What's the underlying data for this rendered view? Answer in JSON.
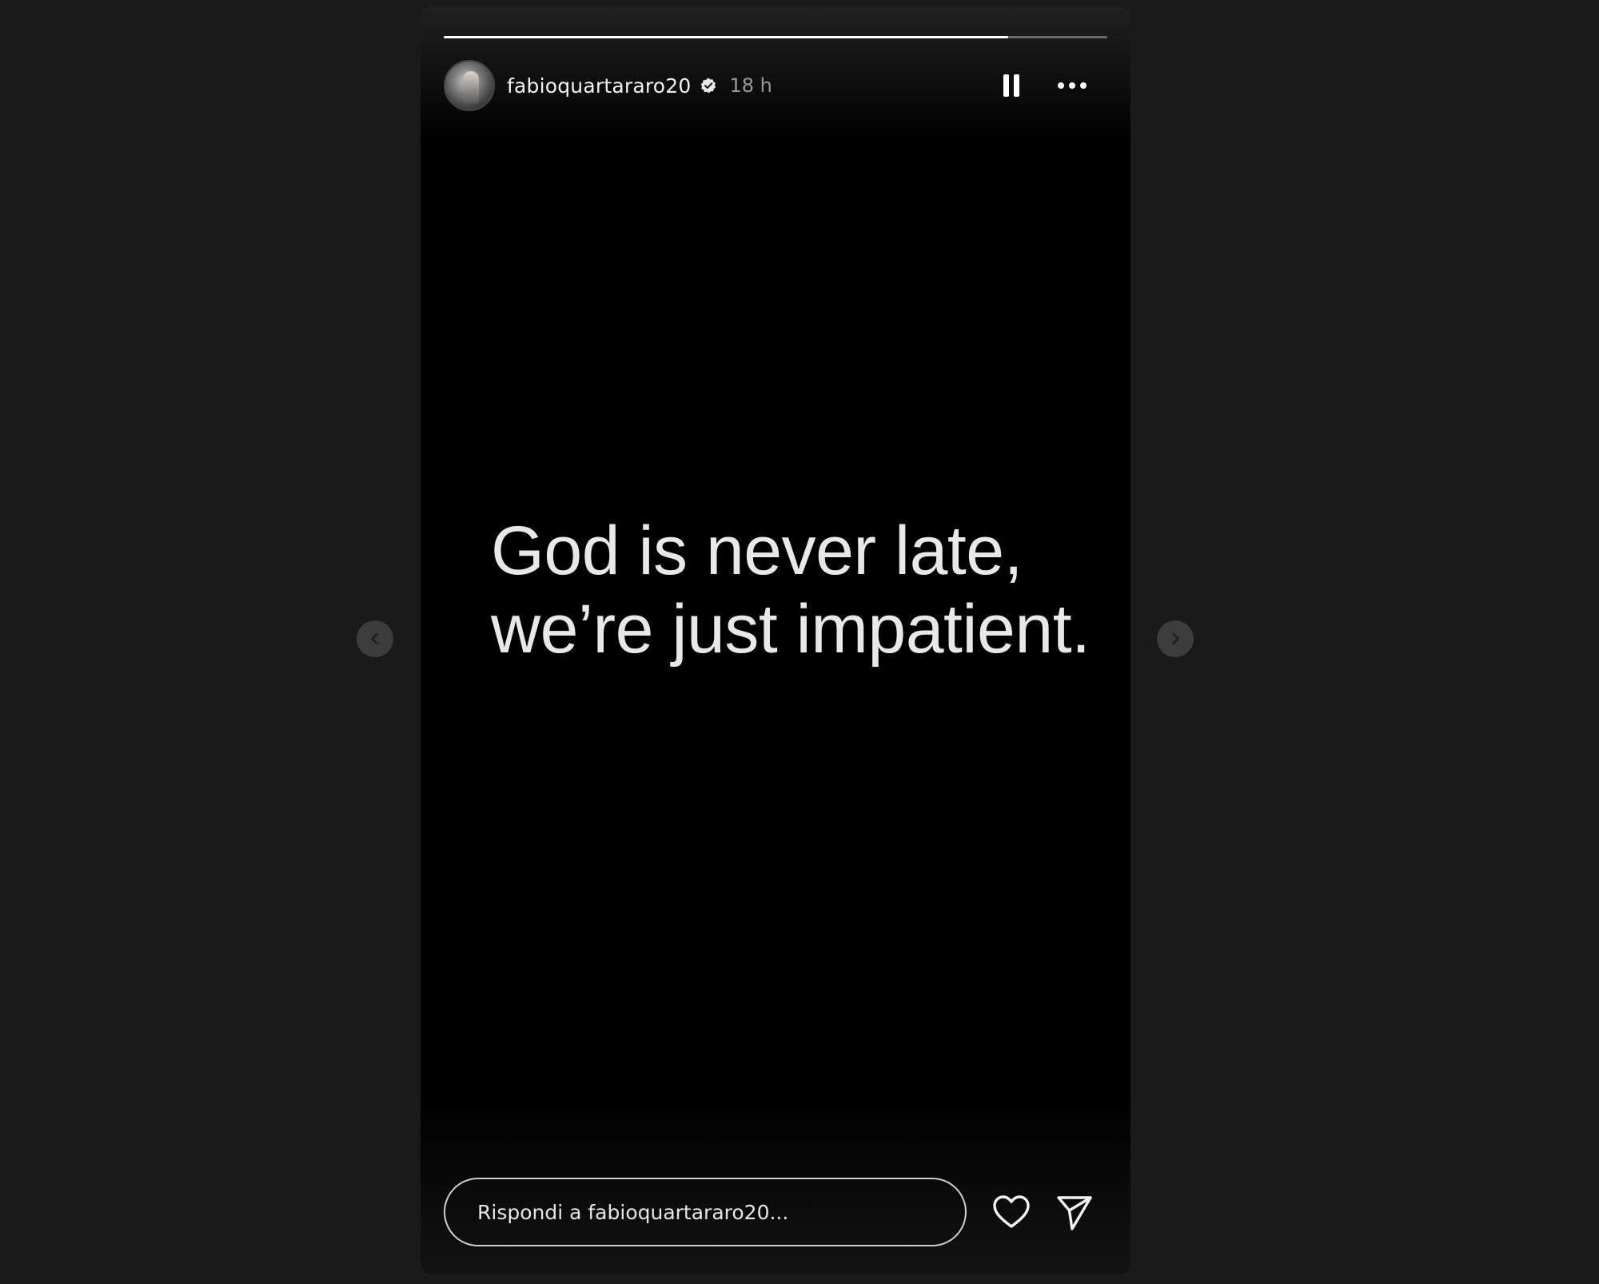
{
  "story": {
    "progress_fraction": 0.85,
    "username": "fabioquartararo20",
    "verified_icon": "verified-badge-icon",
    "time_ago": "18 h",
    "quote_text": "God is never late,\nwe’re just impatient."
  },
  "controls": {
    "pause_icon": "pause-icon",
    "more_icon": "more-options-icon",
    "prev_icon": "chevron-left-icon",
    "next_icon": "chevron-right-icon"
  },
  "reply": {
    "placeholder": "Rispondi a fabioquartararo20...",
    "like_icon": "heart-icon",
    "share_icon": "send-icon"
  },
  "colors": {
    "background": "#1a1a1a",
    "story_background": "#000000",
    "text_primary": "#f2f2f2",
    "text_muted": "#9a9a9a"
  }
}
